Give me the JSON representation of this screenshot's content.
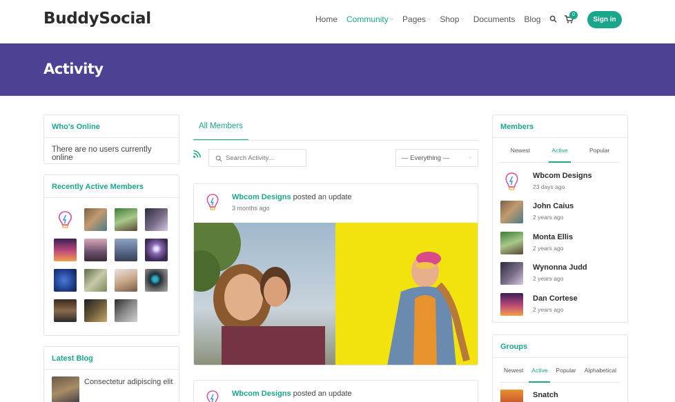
{
  "header": {
    "logo": "BuddySocial",
    "nav": [
      {
        "label": "Home",
        "active": false,
        "dropdown": false
      },
      {
        "label": "Community",
        "active": true,
        "dropdown": true
      },
      {
        "label": "Pages",
        "active": false,
        "dropdown": true
      },
      {
        "label": "Shop",
        "active": false,
        "dropdown": true
      },
      {
        "label": "Documents",
        "active": false,
        "dropdown": false
      },
      {
        "label": "Blog",
        "active": false,
        "dropdown": true
      }
    ],
    "cart_count": "0",
    "signin_label": "Sign in"
  },
  "banner": {
    "title": "Activity"
  },
  "sidebar_left": {
    "whos_online": {
      "title": "Who's Online",
      "message": "There are no users currently online"
    },
    "recent_members": {
      "title": "Recently Active Members",
      "count": 15
    },
    "latest_blog": {
      "title": "Latest Blog",
      "post_title": "Consectetur adipiscing elit"
    }
  },
  "activity": {
    "tab_label": "All Members",
    "search_placeholder": "Search Activity...",
    "filter_value": "— Everything —",
    "posts": [
      {
        "author": "Wbcom Designs",
        "action": "posted an update",
        "time": "3 months ago"
      },
      {
        "author": "Wbcom Designs",
        "action": "posted an update"
      }
    ]
  },
  "sidebar_right": {
    "members": {
      "title": "Members",
      "tabs": [
        "Newest",
        "Active",
        "Popular"
      ],
      "active_tab": "Active",
      "list": [
        {
          "name": "Wbcom Designs",
          "time": "23 days ago"
        },
        {
          "name": "John Caius",
          "time": "2 years ago"
        },
        {
          "name": "Monta Ellis",
          "time": "2 years ago"
        },
        {
          "name": "Wynonna Judd",
          "time": "2 years ago"
        },
        {
          "name": "Dan Cortese",
          "time": "2 years ago"
        }
      ]
    },
    "groups": {
      "title": "Groups",
      "tabs": [
        "Newest",
        "Active",
        "Popular",
        "Alphabetical"
      ],
      "active_tab": "Active",
      "first_group": "Snatch"
    }
  },
  "colors": {
    "accent": "#1ba58b",
    "banner": "#4c4193"
  }
}
